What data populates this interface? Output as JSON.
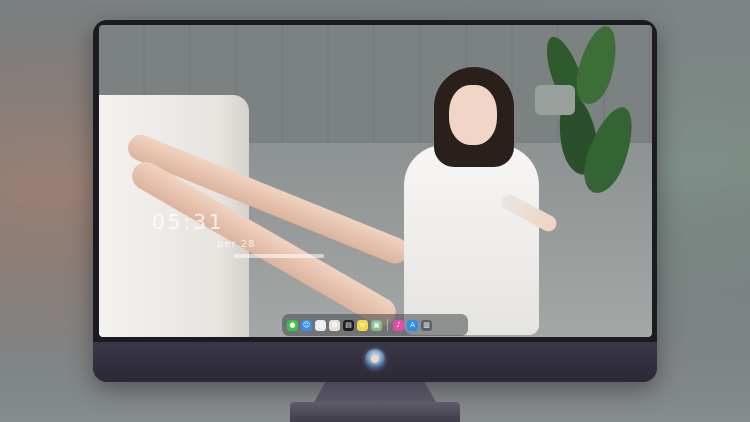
{
  "lock_screen": {
    "time": "05:31",
    "date": "per 28"
  },
  "dock": {
    "icons": [
      {
        "name": "messages-icon",
        "color": "#3cc44a",
        "glyph": "●"
      },
      {
        "name": "finder-icon",
        "color": "#3b8ee8",
        "glyph": "☺"
      },
      {
        "name": "safari-icon",
        "color": "#e8ecef",
        "glyph": "◎"
      },
      {
        "name": "photos-icon",
        "color": "#e7e2da",
        "glyph": "✿"
      },
      {
        "name": "clapper-icon",
        "color": "#1e1e22",
        "glyph": "▤"
      },
      {
        "name": "notes-icon",
        "color": "#f5d74a",
        "glyph": "≡"
      },
      {
        "name": "preview-icon",
        "color": "#7fbf8a",
        "glyph": "▣"
      },
      {
        "name": "music-icon",
        "color": "#e54aa8",
        "glyph": "♪"
      },
      {
        "name": "app-store-icon",
        "color": "#2d8cf0",
        "glyph": "A"
      },
      {
        "name": "trash-icon",
        "color": "#5c6066",
        "glyph": "▥"
      }
    ]
  },
  "colors": {
    "monitor_frame": "#1d1b22",
    "monitor_chin": "#3b3748"
  }
}
